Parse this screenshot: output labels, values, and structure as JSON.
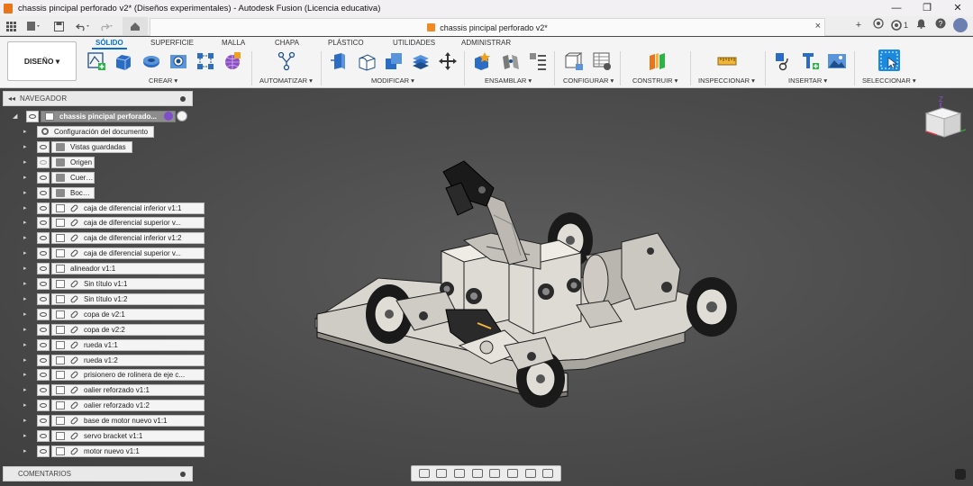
{
  "window": {
    "title": "chassis pincipal perforado v2* (Diseños experimentales) - Autodesk Fusion (Licencia educativa)",
    "controls": [
      "—",
      "❐",
      "✕"
    ]
  },
  "tabbar": {
    "document_tab": "chassis pincipal perforado v2*",
    "close": "×",
    "add": "+",
    "job_count": "1"
  },
  "ribbon": {
    "workspace": "DISEÑO ▾",
    "tabs": [
      "SÓLIDO",
      "SUPERFICIE",
      "MALLA",
      "CHAPA",
      "PLÁSTICO",
      "UTILIDADES",
      "ADMINISTRAR"
    ],
    "groups": [
      "CREAR ▾",
      "AUTOMATIZAR ▾",
      "MODIFICAR ▾",
      "ENSAMBLAR ▾",
      "CONFIGURAR ▾",
      "CONSTRUIR ▾",
      "INSPECCIONAR ▾",
      "INSERTAR ▾",
      "SELECCIONAR ▾"
    ]
  },
  "browser": {
    "header": "NAVEGADOR",
    "root": "chassis pincipal perforado...",
    "items": [
      {
        "label": "Configuración del documento",
        "icon": "gear-icon"
      },
      {
        "label": "Vistas guardadas",
        "icon": "folder-icon"
      },
      {
        "label": "Origen",
        "icon": "folder-icon"
      },
      {
        "label": "Cuerpos",
        "icon": "folder-icon"
      },
      {
        "label": "Bocetos",
        "icon": "folder-icon"
      },
      {
        "label": "caja de diferencial inferior v1:1",
        "icon": "link-icon"
      },
      {
        "label": "caja de diferencial superior v...",
        "icon": "link-icon"
      },
      {
        "label": "caja de diferencial inferior v1:2",
        "icon": "link-icon"
      },
      {
        "label": "caja de diferencial superior v...",
        "icon": "link-icon"
      },
      {
        "label": "alineador v1:1",
        "icon": "component-icon"
      },
      {
        "label": "Sin título v1:1",
        "icon": "link-icon"
      },
      {
        "label": "Sin título v1:2",
        "icon": "link-icon"
      },
      {
        "label": "copa de v2:1",
        "icon": "link-icon"
      },
      {
        "label": "copa de v2:2",
        "icon": "link-icon"
      },
      {
        "label": "rueda v1:1",
        "icon": "link-icon"
      },
      {
        "label": "rueda v1:2",
        "icon": "link-icon"
      },
      {
        "label": "prisionero de rolinera de eje c...",
        "icon": "link-icon"
      },
      {
        "label": "oalier reforzado v1:1",
        "icon": "link-icon"
      },
      {
        "label": "oalier reforzado v1:2",
        "icon": "link-icon"
      },
      {
        "label": "base de motor nuevo v1:1",
        "icon": "link-icon"
      },
      {
        "label": "servo bracket v1:1",
        "icon": "link-icon"
      },
      {
        "label": "motor nuevo v1:1",
        "icon": "link-icon"
      }
    ]
  },
  "comments": {
    "label": "COMENTARIOS"
  },
  "viewcube": {
    "axis_label": "Z"
  }
}
